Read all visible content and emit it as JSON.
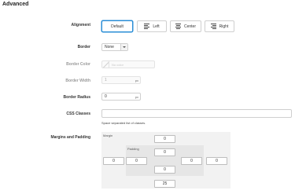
{
  "section": {
    "title": "Advanced"
  },
  "alignment": {
    "label": "Alignment",
    "options": [
      "Default",
      "Left",
      "Center",
      "Right"
    ],
    "selected": "Default"
  },
  "border": {
    "label": "Border",
    "value": "None"
  },
  "border_color": {
    "label": "Border Color",
    "placeholder": "No color"
  },
  "border_width": {
    "label": "Border Width",
    "value": "1",
    "unit": "px"
  },
  "border_radius": {
    "label": "Border Radius",
    "value": "0",
    "unit": "px"
  },
  "css_classes": {
    "label": "CSS Classes",
    "value": "",
    "hint": "Space separated list of classes."
  },
  "margins_padding": {
    "label": "Margins and Padding",
    "margin_label": "Margin",
    "padding_label": "Padding",
    "margin": {
      "top": "0",
      "right": "0",
      "bottom": "25",
      "left": "0"
    },
    "padding": {
      "top": "0",
      "right": "0",
      "bottom": "0",
      "left": "0"
    }
  }
}
